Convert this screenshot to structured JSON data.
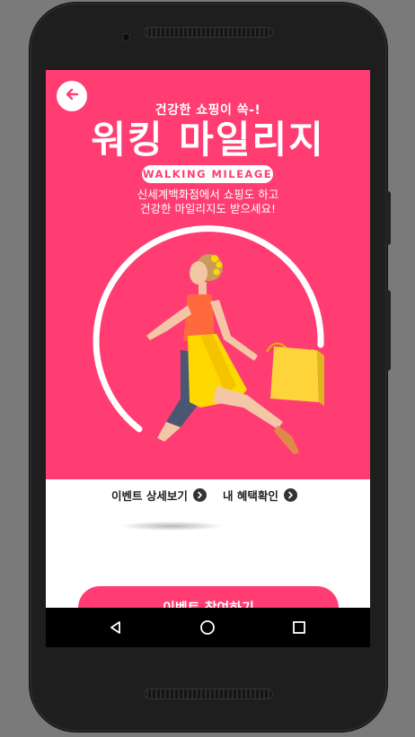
{
  "header": {
    "kicker": "건강한 쇼핑이 쏙-!",
    "title": "워킹 마일리지",
    "badge": "WALKING MILEAGE",
    "description_line1": "신세계백화점에서 쇼핑도 하고",
    "description_line2": "건강한 마일리지도 받으세요!"
  },
  "links": {
    "event_detail": "이벤트 상세보기",
    "my_benefits": "내 혜택확인"
  },
  "cta": {
    "label": "이벤트 참여하기"
  },
  "icons": {
    "back": "arrow-left-icon",
    "link_go": "chevron-right-icon",
    "nav_back": "triangle-back-icon",
    "nav_home": "circle-home-icon",
    "nav_recents": "square-recents-icon"
  },
  "colors": {
    "brand_pink": "#ff3d73",
    "dress_yellow": "#ffd800",
    "bag_yellow": "#ffd43a",
    "top_orange": "#ff6a3d"
  }
}
